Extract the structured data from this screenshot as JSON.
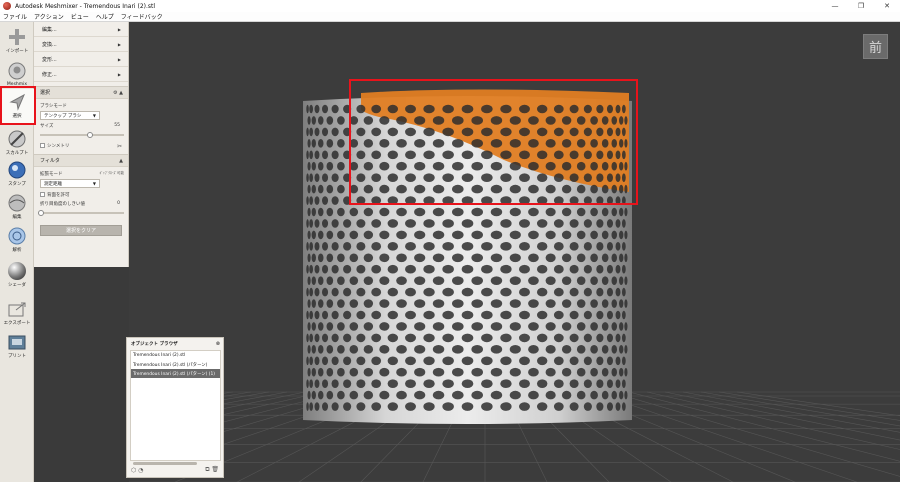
{
  "window": {
    "title": "Autodesk Meshmixer - Tremendous Inari (2).stl",
    "controls": [
      "—",
      "❐",
      "✕"
    ]
  },
  "menubar": [
    "ファイル",
    "アクション",
    "ビュー",
    "ヘルプ",
    "フィードバック"
  ],
  "toolbar": [
    {
      "label": "インポート",
      "icon": "import-icon"
    },
    {
      "label": "Meshmix",
      "icon": "meshmix-icon"
    },
    {
      "label": "選択",
      "icon": "select-icon",
      "active": true
    },
    {
      "label": "スカルプト",
      "icon": "sculpt-icon"
    },
    {
      "label": "スタンプ",
      "icon": "stamp-icon"
    },
    {
      "label": "編集",
      "icon": "edit-icon"
    },
    {
      "label": "解析",
      "icon": "analysis-icon"
    },
    {
      "label": "シェーダ",
      "icon": "shader-icon"
    },
    {
      "label": "エクスポート",
      "icon": "export-icon"
    },
    {
      "label": "プリント",
      "icon": "print-icon"
    }
  ],
  "panel": {
    "menu_items": [
      "編集...",
      "変換...",
      "変形...",
      "修正..."
    ],
    "select_section": {
      "title": "選択",
      "brush_mode_label": "ブラシモード",
      "brush_mode_value": "テンクップ ブラシ",
      "size_label": "サイズ",
      "size_value": "55",
      "symmetry_label": "シンメトリ"
    },
    "filter_section": {
      "title": "フィルタ",
      "expand_mode_label": "拡張モード",
      "expand_mode_side": "ｷﾞｬﾌﾞｸﾛｰｽﾞ可能",
      "expand_mode_value": "測定距離",
      "allow_backface_label": "背面を許可",
      "crease_angle_label": "折り目角度のしきい値",
      "crease_angle_value": "0"
    },
    "clear_button": "選択をクリア"
  },
  "viewcube": {
    "label": "前"
  },
  "object_browser": {
    "title": "オブジェクト ブラウザ",
    "items": [
      "Tremendous Inari (2).stl",
      "Tremendous Inari (2).stl (パターン)",
      "Tremendous Inari (2).stl (パターン) (1)"
    ],
    "selected_index": 2
  },
  "colors": {
    "viewport_bg": "#3c3c3c",
    "grid": "#565656",
    "mesh": "#bdbdbd",
    "selection": "#e07d22",
    "highlight_box": "#e8131b"
  }
}
